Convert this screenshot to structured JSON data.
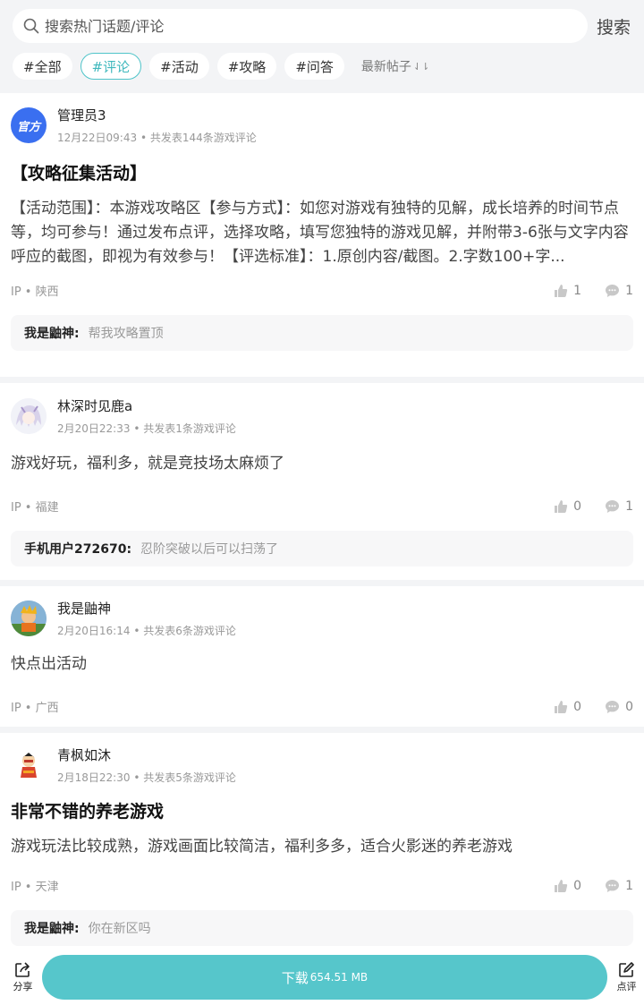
{
  "search": {
    "placeholder": "搜索热门话题/评论",
    "button_label": "搜索"
  },
  "tags": [
    {
      "label": "#全部"
    },
    {
      "label": "#评论"
    },
    {
      "label": "#活动"
    },
    {
      "label": "#攻略"
    },
    {
      "label": "#问答"
    }
  ],
  "active_tag_index": 1,
  "sort": {
    "label": "最新帖子",
    "icon": "sort-icon"
  },
  "posts": [
    {
      "avatar_text": "官方",
      "username": "管理员3",
      "time": "12月22日09:43",
      "post_count": "共发表144条游戏评论",
      "title": "【攻略征集活动】",
      "body": "【活动范围】：本游戏攻略区【参与方式】：如您对游戏有独特的见解，成长培养的时间节点等，均可参与！通过发布点评，选择攻略，填写您独特的游戏见解，并附带3-6张与文字内容呼应的截图，即视为有效参与！【评选标准】：1.原创内容/截图。2.字数100+字...",
      "ip": "IP • 陕西",
      "likes": "1",
      "comments": "1",
      "reply_author": "我是鼬神:",
      "reply_text": "帮我攻略置顶"
    },
    {
      "username": "林深时见鹿a",
      "time": "2月20日22:33",
      "post_count": "共发表1条游戏评论",
      "body": "游戏好玩，福利多，就是竞技场太麻烦了",
      "ip": "IP • 福建",
      "likes": "0",
      "comments": "1",
      "reply_author": "手机用户272670:",
      "reply_text": "忍阶突破以后可以扫荡了"
    },
    {
      "username": "我是鼬神",
      "time": "2月20日16:14",
      "post_count": "共发表6条游戏评论",
      "body": "快点出活动",
      "ip": "IP • 广西",
      "likes": "0",
      "comments": "0"
    },
    {
      "username": "青枫如沐",
      "time": "2月18日22:30",
      "post_count": "共发表5条游戏评论",
      "title": "非常不错的养老游戏",
      "body": "游戏玩法比较成熟，游戏画面比较简洁，福利多多，适合火影迷的养老游戏",
      "ip": "IP • 天津",
      "likes": "0",
      "comments": "1",
      "reply_author": "我是鼬神:",
      "reply_text": "你在新区吗"
    }
  ],
  "bottom_bar": {
    "share_label": "分享",
    "download_label": "下载",
    "download_size": "654.51 MB",
    "review_label": "点评"
  },
  "colors": {
    "accent": "#56c6cb",
    "official_avatar": "#3a6ff0",
    "background": "#f3f4f6"
  }
}
